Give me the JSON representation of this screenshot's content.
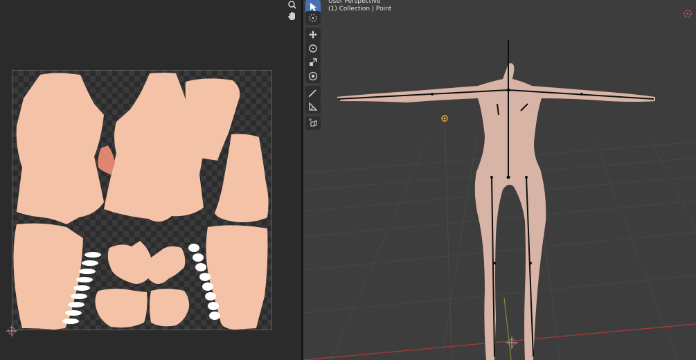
{
  "viewport": {
    "view_name": "User Perspective",
    "collection_info": "(1) Collection | Point"
  },
  "icons": {
    "zoom": "zoom-icon",
    "pan": "hand-icon",
    "select": "select-box-icon",
    "cursor": "3d-cursor-icon",
    "move": "move-icon",
    "rotate": "rotate-icon",
    "scale": "scale-icon",
    "transform": "transform-icon",
    "annotate": "annotate-icon",
    "measure": "measure-icon",
    "add_cube": "add-cube-icon"
  },
  "colors": {
    "skin_texture": "#f5c3a8",
    "model_skin": "#d8b4a6",
    "active_tool": "#4772b3",
    "grid_x_axis": "#a13a3a",
    "grid_y_axis": "#6d9a3a"
  }
}
